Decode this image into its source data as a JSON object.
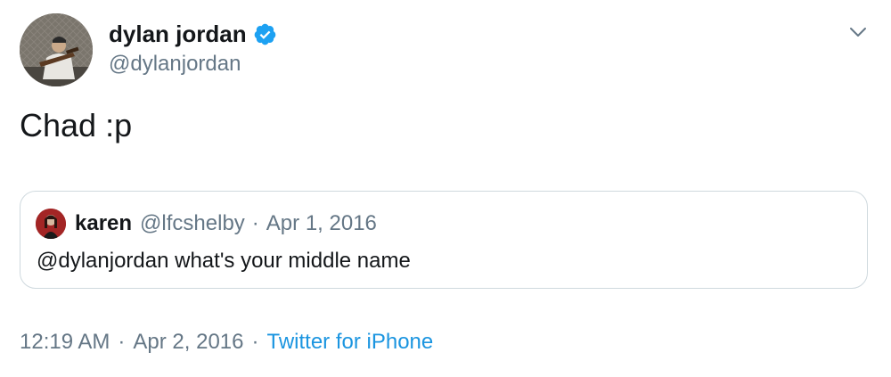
{
  "author": {
    "display_name": "dylan jordan",
    "handle": "@dylanjordan",
    "verified": true
  },
  "tweet": {
    "text": "Chad :p"
  },
  "quoted_tweet": {
    "display_name": "karen",
    "handle": "@lfcshelby",
    "separator": "·",
    "date": "Apr 1, 2016",
    "text": "@dylanjordan what's your middle name"
  },
  "footer": {
    "time": "12:19 AM",
    "separator": "·",
    "date": "Apr 2, 2016",
    "source": "Twitter for iPhone"
  },
  "icons": {
    "verified": "verified-badge-icon",
    "menu": "chevron-down-icon"
  },
  "colors": {
    "primary_text": "#14171a",
    "secondary_text": "#657786",
    "link": "#1b95e0",
    "verified": "#1da1f2",
    "border": "#cfd9de"
  }
}
